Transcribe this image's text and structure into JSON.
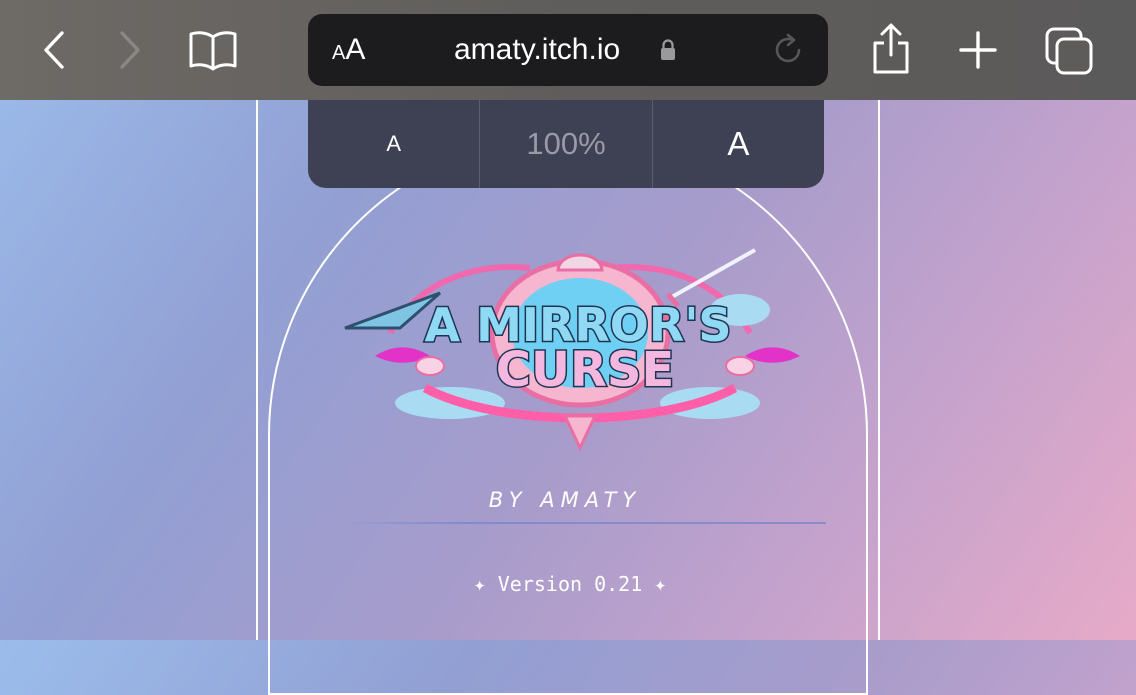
{
  "browser": {
    "text_size_button": {
      "small": "A",
      "large": "A"
    },
    "url": "amaty.itch.io"
  },
  "text_size_popover": {
    "decrease_label": "A",
    "zoom_level": "100%",
    "increase_label": "A"
  },
  "page": {
    "logo": {
      "line1": "A MIRROR'S",
      "line2": "CURSE"
    },
    "byline": "BY AMATY",
    "version": "✦ Version 0.21 ✦"
  }
}
